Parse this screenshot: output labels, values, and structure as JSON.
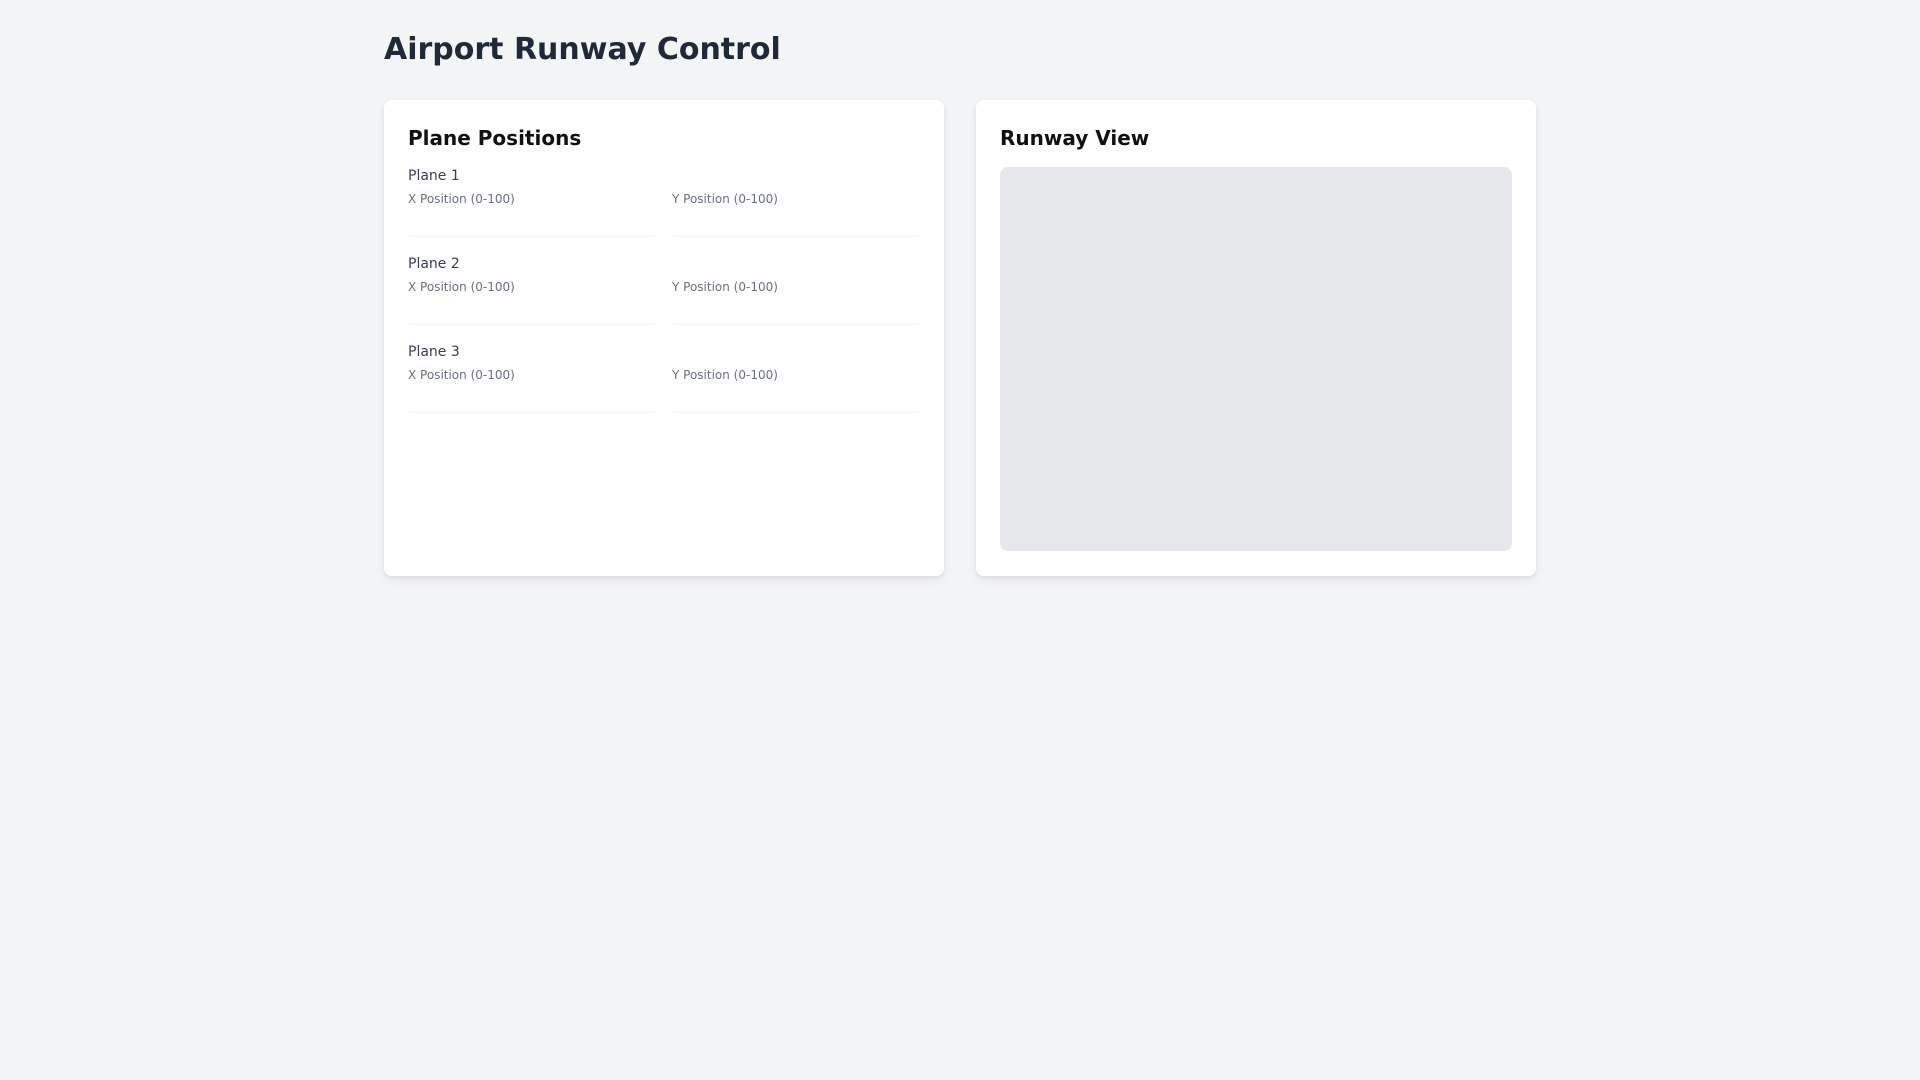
{
  "page": {
    "title": "Airport Runway Control"
  },
  "positions_panel": {
    "title": "Plane Positions",
    "planes": [
      {
        "label": "Plane 1",
        "x_label": "X Position (0-100)",
        "y_label": "Y Position (0-100)",
        "x_value": "",
        "y_value": ""
      },
      {
        "label": "Plane 2",
        "x_label": "X Position (0-100)",
        "y_label": "Y Position (0-100)",
        "x_value": "",
        "y_value": ""
      },
      {
        "label": "Plane 3",
        "x_label": "X Position (0-100)",
        "y_label": "Y Position (0-100)",
        "x_value": "",
        "y_value": ""
      }
    ]
  },
  "runway_panel": {
    "title": "Runway View"
  },
  "colors": {
    "background": "#f3f4f6",
    "card": "#ffffff",
    "runway": "#e5e7eb",
    "title_text": "#1f2937",
    "muted_text": "#6b7280"
  }
}
